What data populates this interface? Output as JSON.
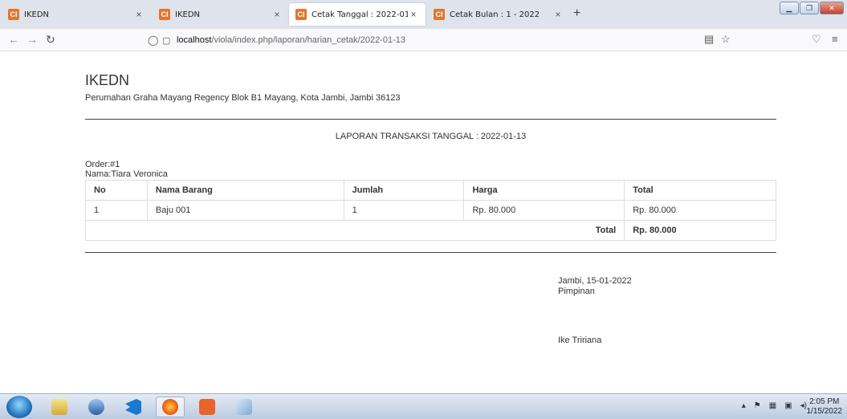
{
  "browser": {
    "tabs": [
      {
        "title": "IKEDN",
        "active": false
      },
      {
        "title": "IKEDN",
        "active": false
      },
      {
        "title": "Cetak Tanggal : 2022-01-13",
        "active": true
      },
      {
        "title": "Cetak Bulan : 1 - 2022",
        "active": false
      }
    ],
    "url_host": "localhost",
    "url_path": "/viola/index.php/laporan/harian_cetak/2022-01-13"
  },
  "report": {
    "company": "IKEDN",
    "address": "Perumahan Graha Mayang Regency Blok B1 Mayang, Kota Jambi, Jambi 36123",
    "title": "LAPORAN TRANSAKSI TANGGAL : 2022-01-13",
    "order_label": "Order:#1",
    "customer_label": "Nama:Tiara Veronica",
    "table": {
      "headers": [
        "No",
        "Nama Barang",
        "Jumlah",
        "Harga",
        "Total"
      ],
      "rows": [
        [
          "1",
          "Baju 001",
          "1",
          "Rp. 80.000",
          "Rp. 80.000"
        ]
      ],
      "total_label": "Total",
      "total_value": "Rp. 80.000"
    },
    "signature": {
      "place_date": "Jambi, 15-01-2022",
      "role": "Pimpinan",
      "name": "Ike Tririana"
    }
  },
  "taskbar": {
    "time": "2:05 PM",
    "date": "1/15/2022"
  }
}
